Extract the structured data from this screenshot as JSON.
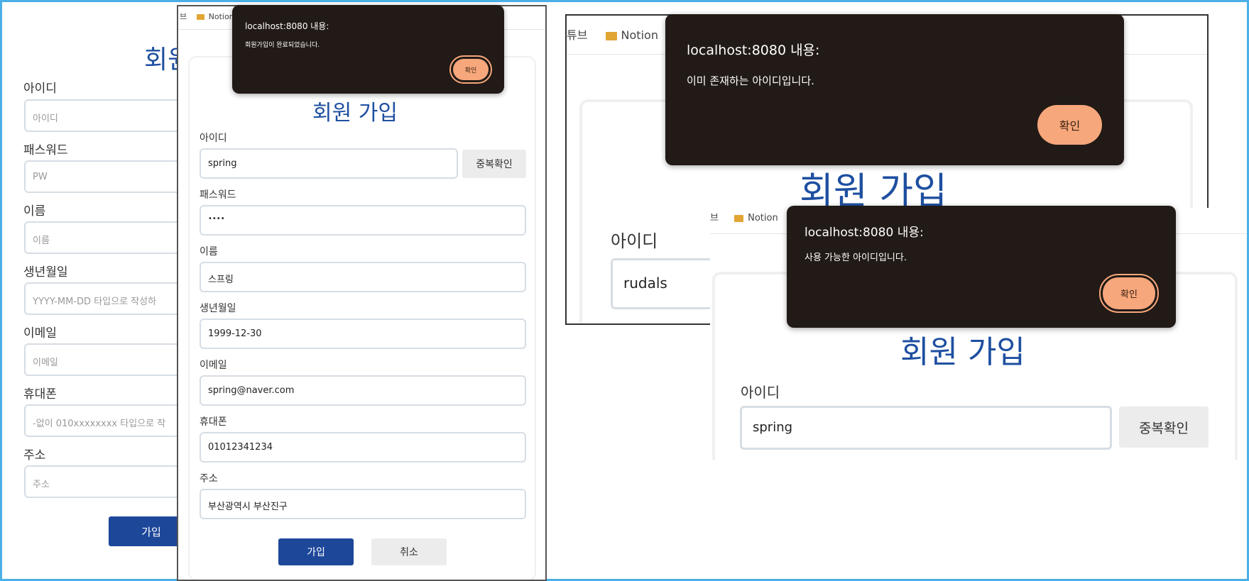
{
  "p1": {
    "title": "회원",
    "labels": [
      "아이디",
      "패스워드",
      "이름",
      "생년월일",
      "이메일",
      "휴대폰",
      "주소"
    ],
    "placeholders": [
      "아이디",
      "PW",
      "이름",
      "YYYY-MM-DD 타입으로 작성하",
      "이메일",
      "-없이 010xxxxxxxx 타입으로 작",
      "주소"
    ],
    "submit": "가입"
  },
  "p2": {
    "tab_left": "브",
    "tab_notion": "Notion",
    "title": "회원 가입",
    "labels": [
      "아이디",
      "패스워드",
      "이름",
      "생년월일",
      "이메일",
      "휴대폰",
      "주소"
    ],
    "values": [
      "spring",
      "••••",
      "스프링",
      "1999-12-30",
      "spring@naver.com",
      "01012341234",
      "부산광역시 부산진구"
    ],
    "dup_button": "중복확인",
    "submit": "가입",
    "cancel": "취소",
    "alert": {
      "host": "localhost:8080 내용:",
      "message": "회원가입이 완료되었습니다.",
      "ok": "확인"
    }
  },
  "p3": {
    "tab_left": "튜브",
    "tab_notion": "Notion",
    "title": "회원 가입",
    "id_label": "아이디",
    "id_value": "rudals",
    "alert": {
      "host": "localhost:8080 내용:",
      "message": "이미 존재하는 아이디입니다.",
      "ok": "확인"
    }
  },
  "p4": {
    "tab_left": "브",
    "tab_notion": "Notion",
    "title": "회원 가입",
    "id_label": "아이디",
    "id_value": "spring",
    "dup_button": "중복확인",
    "alert": {
      "host": "localhost:8080 내용:",
      "message": "사용 가능한 아이디입니다.",
      "ok": "확인"
    }
  },
  "colors": {
    "frame": "#4ab0e6",
    "title": "#1e4fa0",
    "primary": "#1d4799",
    "alert_bg": "#211a16",
    "ok_button": "#f6a77b"
  }
}
